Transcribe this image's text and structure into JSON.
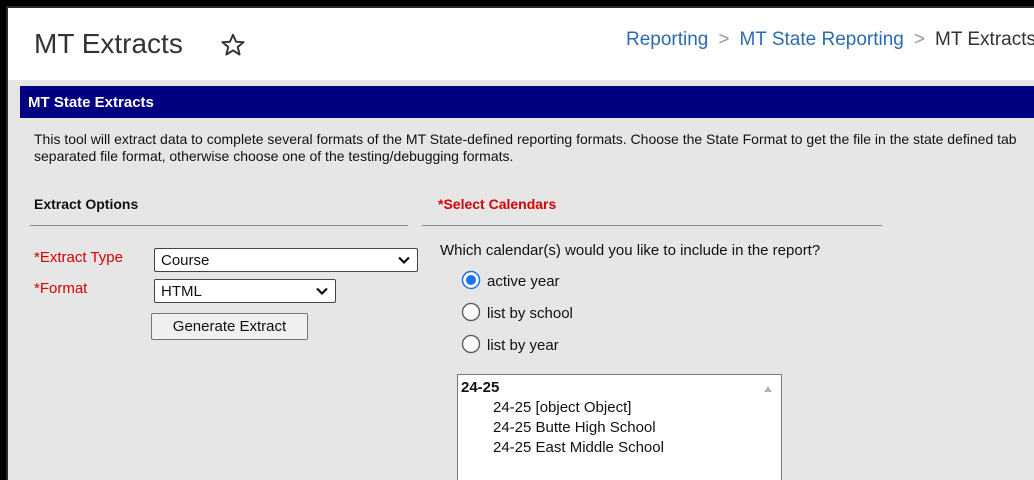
{
  "header": {
    "title": "MT Extracts",
    "breadcrumb": [
      "Reporting",
      "MT State Reporting",
      "MT Extracts"
    ]
  },
  "section": {
    "title": "MT State Extracts",
    "description": "This tool will extract data to complete several formats of the MT State-defined reporting formats. Choose the State Format to get the file in the state defined tab separated file format, otherwise choose one of the testing/debugging formats."
  },
  "extract_options": {
    "title": "Extract Options",
    "extract_type_label": "*Extract Type",
    "extract_type_value": "Course",
    "format_label": "*Format",
    "format_value": "HTML",
    "generate_label": "Generate Extract"
  },
  "calendars": {
    "title": "*Select Calendars",
    "question": "Which calendar(s) would you like to include in the report?",
    "options": [
      {
        "label": "active year",
        "selected": true
      },
      {
        "label": "list by school",
        "selected": false
      },
      {
        "label": "list by year",
        "selected": false
      }
    ],
    "list_group": "24-25",
    "list_items": [
      "24-25 [object Object]",
      "24-25 Butte High School",
      "24-25 East Middle School"
    ]
  },
  "colors": {
    "section_header": "#000080",
    "required": "#d40000",
    "link": "#2b6cb0"
  },
  "icons": [
    "star-icon",
    "chevron-down-icon",
    "radio-selected-icon",
    "radio-empty-icon",
    "scroll-up-arrow-icon"
  ]
}
